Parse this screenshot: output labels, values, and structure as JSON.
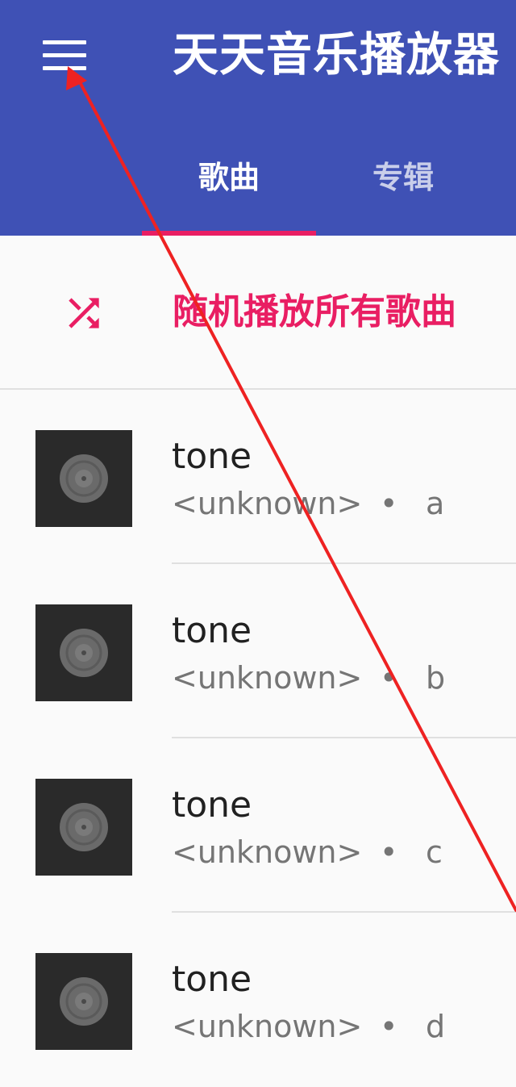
{
  "app_bar": {
    "title": "天天音乐播放器",
    "menu_icon": "hamburger-menu-icon",
    "background_color": "#3f51b5"
  },
  "tabs": [
    {
      "label": "歌曲",
      "selected": true
    },
    {
      "label": "专辑",
      "selected": false
    }
  ],
  "accent_color": "#e91e63",
  "shuffle": {
    "icon": "shuffle-icon",
    "label": "随机播放所有歌曲"
  },
  "songs": [
    {
      "title": "tone",
      "artist": "<unknown>",
      "separator": "•",
      "album": "a",
      "art_icon": "vinyl-record-icon"
    },
    {
      "title": "tone",
      "artist": "<unknown>",
      "separator": "•",
      "album": "b",
      "art_icon": "vinyl-record-icon"
    },
    {
      "title": "tone",
      "artist": "<unknown>",
      "separator": "•",
      "album": "c",
      "art_icon": "vinyl-record-icon"
    },
    {
      "title": "tone",
      "artist": "<unknown>",
      "separator": "•",
      "album": "d",
      "art_icon": "vinyl-record-icon"
    }
  ]
}
